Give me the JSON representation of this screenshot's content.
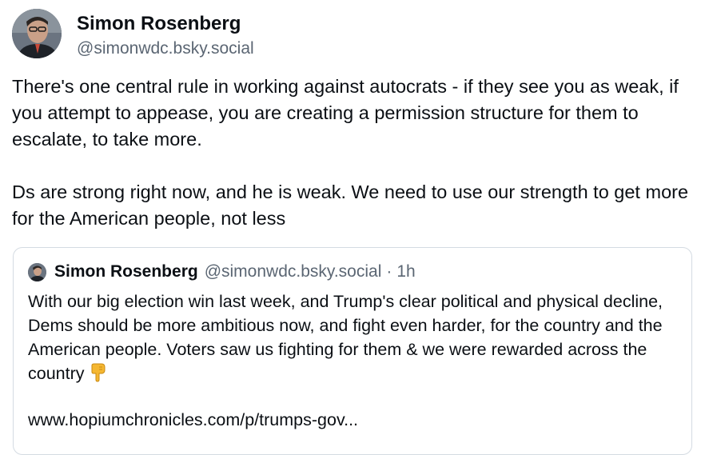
{
  "author": {
    "display_name": "Simon Rosenberg",
    "handle": "@simonwdc.bsky.social",
    "avatar_icon": "profile-photo"
  },
  "post": {
    "paragraphs": [
      "There's one central rule in working against autocrats - if they see you as weak, if you attempt to appease, you are creating a permission structure for them to escalate, to take more.",
      "Ds are strong right now, and he is weak.  We need to use our strength to get more for the American people, not less"
    ]
  },
  "quote": {
    "display_name": "Simon Rosenberg",
    "handle": "@simonwdc.bsky.social",
    "separator": "·",
    "time": "1h",
    "text": "With our big election win last week, and Trump's clear political and physical decline, Dems should be more ambitious now, and fight even harder, for the country and the American people.  Voters saw us fighting for them & we were rewarded across the country",
    "emoji_icon": "backhand-index-pointing-down-icon",
    "link": "www.hopiumchronicles.com/p/trumps-gov..."
  },
  "colors": {
    "text": "#0b0f14",
    "muted": "#5b6673",
    "border": "#d4dbe2"
  }
}
